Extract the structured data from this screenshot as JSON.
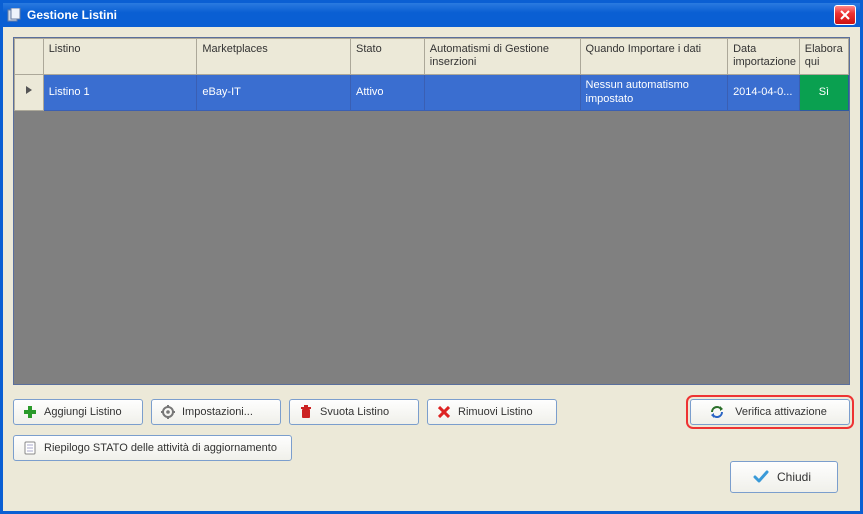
{
  "window": {
    "title": "Gestione Listini"
  },
  "grid": {
    "headers": {
      "listino": "Listino",
      "marketplaces": "Marketplaces",
      "stato": "Stato",
      "automatismi": "Automatismi di Gestione inserzioni",
      "quando": "Quando Importare i dati",
      "data": "Data importazione",
      "elabora": "Elabora qui"
    },
    "rows": [
      {
        "listino": "Listino 1",
        "marketplaces": "eBay-IT",
        "stato": "Attivo",
        "automatismi": "",
        "quando": "Nessun automatismo impostato",
        "data": "2014-04-0...",
        "elabora": "Sì"
      }
    ]
  },
  "buttons": {
    "aggiungi": "Aggiungi Listino",
    "impostazioni": "Impostazioni...",
    "svuota": "Svuota Listino",
    "rimuovi": "Rimuovi Listino",
    "verifica": "Verifica attivazione",
    "riepilogo": "Riepilogo STATO delle attività di aggiornamento",
    "chiudi": "Chiudi"
  }
}
